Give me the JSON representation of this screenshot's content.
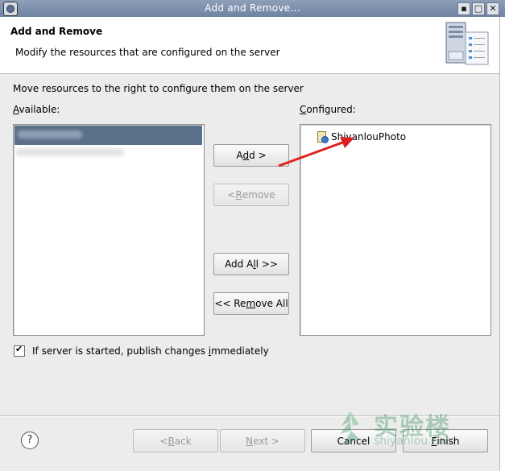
{
  "window": {
    "title": "Add and Remove...",
    "controls": {
      "close": "✕",
      "maximize": "□",
      "minimize": "▪",
      "restore": "▫"
    }
  },
  "header": {
    "title": "Add and Remove",
    "description": "Modify the resources that are configured on the server"
  },
  "instructions": "Move resources to the right to configure them on the server",
  "available": {
    "label_prefix": "",
    "label_mnemonic": "A",
    "label_rest": "vailable:"
  },
  "configured": {
    "label_prefix": "",
    "label_mnemonic": "C",
    "label_rest": "onfigured:",
    "items": [
      "ShiyanlouPhoto"
    ]
  },
  "buttons": {
    "add": {
      "pre": "A",
      "mn": "d",
      "post": "d >"
    },
    "remove": {
      "pre": "< ",
      "mn": "R",
      "post": "emove"
    },
    "add_all": {
      "pre": "Add A",
      "mn": "l",
      "post": "l >>"
    },
    "remove_all": {
      "pre": "<< Re",
      "mn": "m",
      "post": "ove All"
    }
  },
  "publish_checkbox": {
    "checked": true,
    "pre": "If server is started, publish changes ",
    "mn": "i",
    "post": "mmediately"
  },
  "footer": {
    "help": "?",
    "back": {
      "pre": "< ",
      "mn": "B",
      "post": "ack"
    },
    "next": {
      "pre": "",
      "mn": "N",
      "post": "ext >"
    },
    "cancel": "Cancel",
    "finish": {
      "pre": "",
      "mn": "F",
      "post": "inish"
    }
  },
  "watermark": {
    "cn": "实验楼",
    "en": "shiyanlou.com"
  },
  "colors": {
    "titlebar": "#6f83a3",
    "selection": "#5a7088",
    "annotation_arrow": "#e02020"
  }
}
